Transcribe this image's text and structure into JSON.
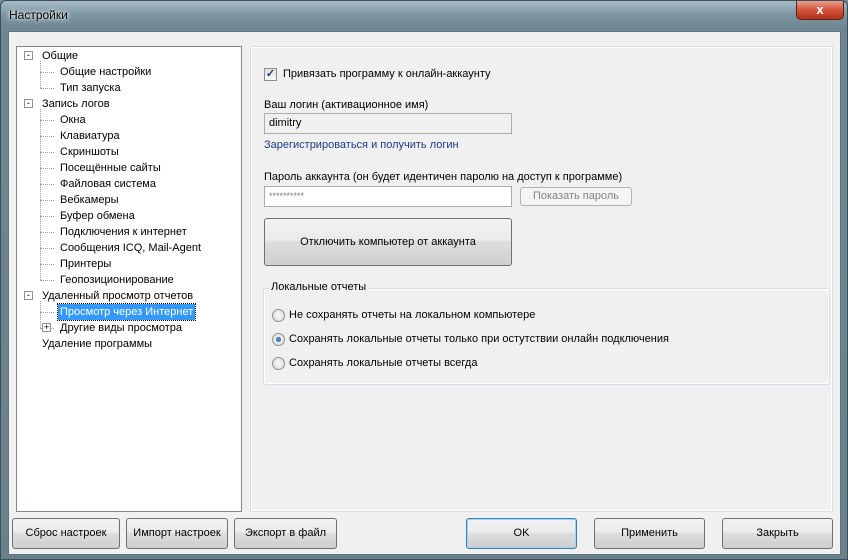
{
  "window": {
    "title": "Настройки",
    "close_glyph": "x"
  },
  "tree": [
    {
      "label": "Общие",
      "level": 0,
      "expander": "-"
    },
    {
      "label": "Общие настройки",
      "level": 1
    },
    {
      "label": "Тип запуска",
      "level": 1
    },
    {
      "label": "Запись логов",
      "level": 0,
      "expander": "-"
    },
    {
      "label": "Окна",
      "level": 1
    },
    {
      "label": "Клавиатура",
      "level": 1
    },
    {
      "label": "Скриншоты",
      "level": 1
    },
    {
      "label": "Посещённые сайты",
      "level": 1
    },
    {
      "label": "Файловая система",
      "level": 1
    },
    {
      "label": "Вебкамеры",
      "level": 1
    },
    {
      "label": "Буфер обмена",
      "level": 1
    },
    {
      "label": "Подключения к интернет",
      "level": 1
    },
    {
      "label": "Сообщения ICQ, Mail-Agent",
      "level": 1
    },
    {
      "label": "Принтеры",
      "level": 1
    },
    {
      "label": "Геопозиционирование",
      "level": 1
    },
    {
      "label": "Удаленный просмотр отчетов",
      "level": 0,
      "expander": "-"
    },
    {
      "label": "Просмотр через Интернет",
      "level": 1,
      "selected": true
    },
    {
      "label": "Другие виды просмотра",
      "level": 1,
      "expander": "+"
    },
    {
      "label": "Удаление программы",
      "level": 0
    }
  ],
  "settings": {
    "bind_checkbox_label": "Привязать программу к онлайн-аккаунту",
    "bind_checked": true,
    "login_label": "Ваш логин (активационное имя)",
    "login_value": "dimitry",
    "register_link": "Зарегистрироваться и получить логин",
    "password_label": "Пароль аккаунта (он будет идентичен паролю на доступ к программе)",
    "password_value": "**********",
    "show_password_button": "Показать пароль",
    "disconnect_button": "Отключить компьютер от аккаунта",
    "local_reports": {
      "title": "Локальные отчеты",
      "options": [
        {
          "label": "Не сохранять отчеты на локальном компьютере",
          "selected": false
        },
        {
          "label": "Сохранять локальные отчеты только при остутствии онлайн подключения",
          "selected": true
        },
        {
          "label": "Сохранять локальные отчеты всегда",
          "selected": false
        }
      ]
    }
  },
  "footer": {
    "reset": "Сброс настроек",
    "import": "Импорт настроек",
    "export": "Экспорт в файл",
    "ok": "OK",
    "apply": "Применить",
    "close": "Закрыть"
  }
}
